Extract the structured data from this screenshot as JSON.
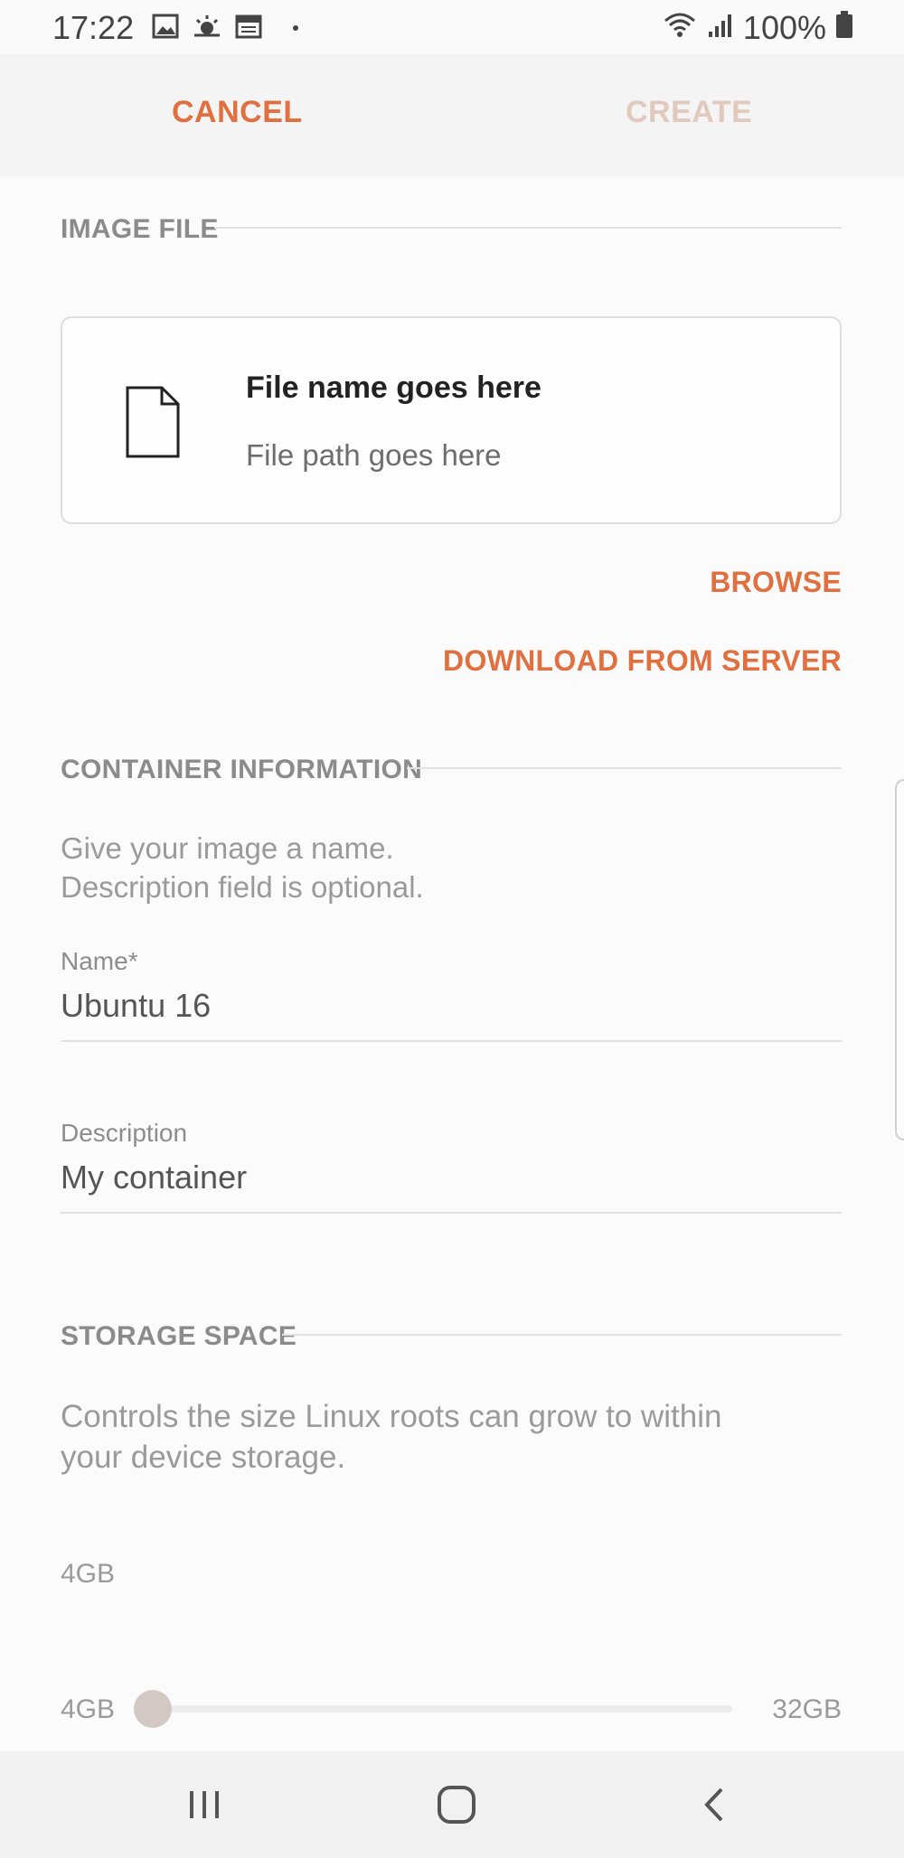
{
  "status_bar": {
    "time": "17:22",
    "battery": "100%",
    "left_icons": [
      "gallery-icon",
      "weather-icon",
      "calendar-icon",
      "dot-icon"
    ],
    "right_icons": [
      "wifi-icon",
      "signal-icon",
      "battery-icon"
    ]
  },
  "action_bar": {
    "cancel_label": "CANCEL",
    "create_label": "CREATE"
  },
  "image_file": {
    "section_title": "IMAGE FILE",
    "file_name": "File name goes here",
    "file_path": "File path goes here",
    "browse_label": "BROWSE",
    "download_label": "DOWNLOAD FROM SERVER"
  },
  "container_info": {
    "section_title": "CONTAINER INFORMATION",
    "description_line1": "Give your image a name.",
    "description_line2": "Description field is optional.",
    "name_label": "Name*",
    "name_value": "Ubuntu 16",
    "desc_label": "Description",
    "desc_value": "My container"
  },
  "storage": {
    "section_title": "STORAGE SPACE",
    "description_line1": "Controls the size Linux roots can grow to within",
    "description_line2": "your device storage.",
    "current_value": "4GB",
    "min_label": "4GB",
    "max_label": "32GB",
    "slider_fraction": 0
  },
  "colors": {
    "accent": "#e07040",
    "disabled": "#e2c9bd"
  }
}
